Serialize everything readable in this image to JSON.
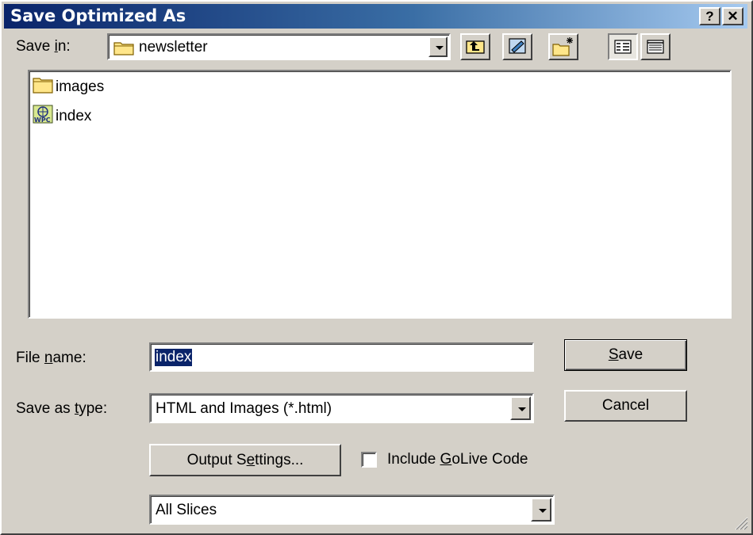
{
  "window": {
    "title": "Save Optimized As",
    "help_glyph": "?",
    "close_glyph": "✕"
  },
  "save_in": {
    "label_pre": "Save ",
    "label_hot": "i",
    "label_post": "n:",
    "value": "newsletter"
  },
  "toolbar": {
    "icons": [
      "up-one-level-icon",
      "desktop-icon",
      "new-folder-icon",
      "list-view-icon",
      "details-view-icon"
    ]
  },
  "files": [
    {
      "name": "images",
      "icon": "folder-icon"
    },
    {
      "name": "index",
      "icon": "html-file-icon"
    }
  ],
  "file_name": {
    "label_pre": "File ",
    "label_hot": "n",
    "label_post": "ame:",
    "value": "index"
  },
  "save_as_type": {
    "label_pre": "Save as ",
    "label_hot": "t",
    "label_post": "ype:",
    "value": "HTML and Images (*.html)"
  },
  "buttons": {
    "save_hot": "S",
    "save_rest": "ave",
    "cancel": "Cancel",
    "output_pre": "Output S",
    "output_hot": "e",
    "output_post": "ttings..."
  },
  "golive": {
    "label_pre": "Include ",
    "label_hot": "G",
    "label_post": "oLive Code",
    "checked": false
  },
  "slices": {
    "value": "All Slices"
  },
  "colors": {
    "title_start": "#0a246a",
    "title_end": "#a6caf0",
    "face": "#d4d0c8",
    "selection": "#0a246a"
  }
}
